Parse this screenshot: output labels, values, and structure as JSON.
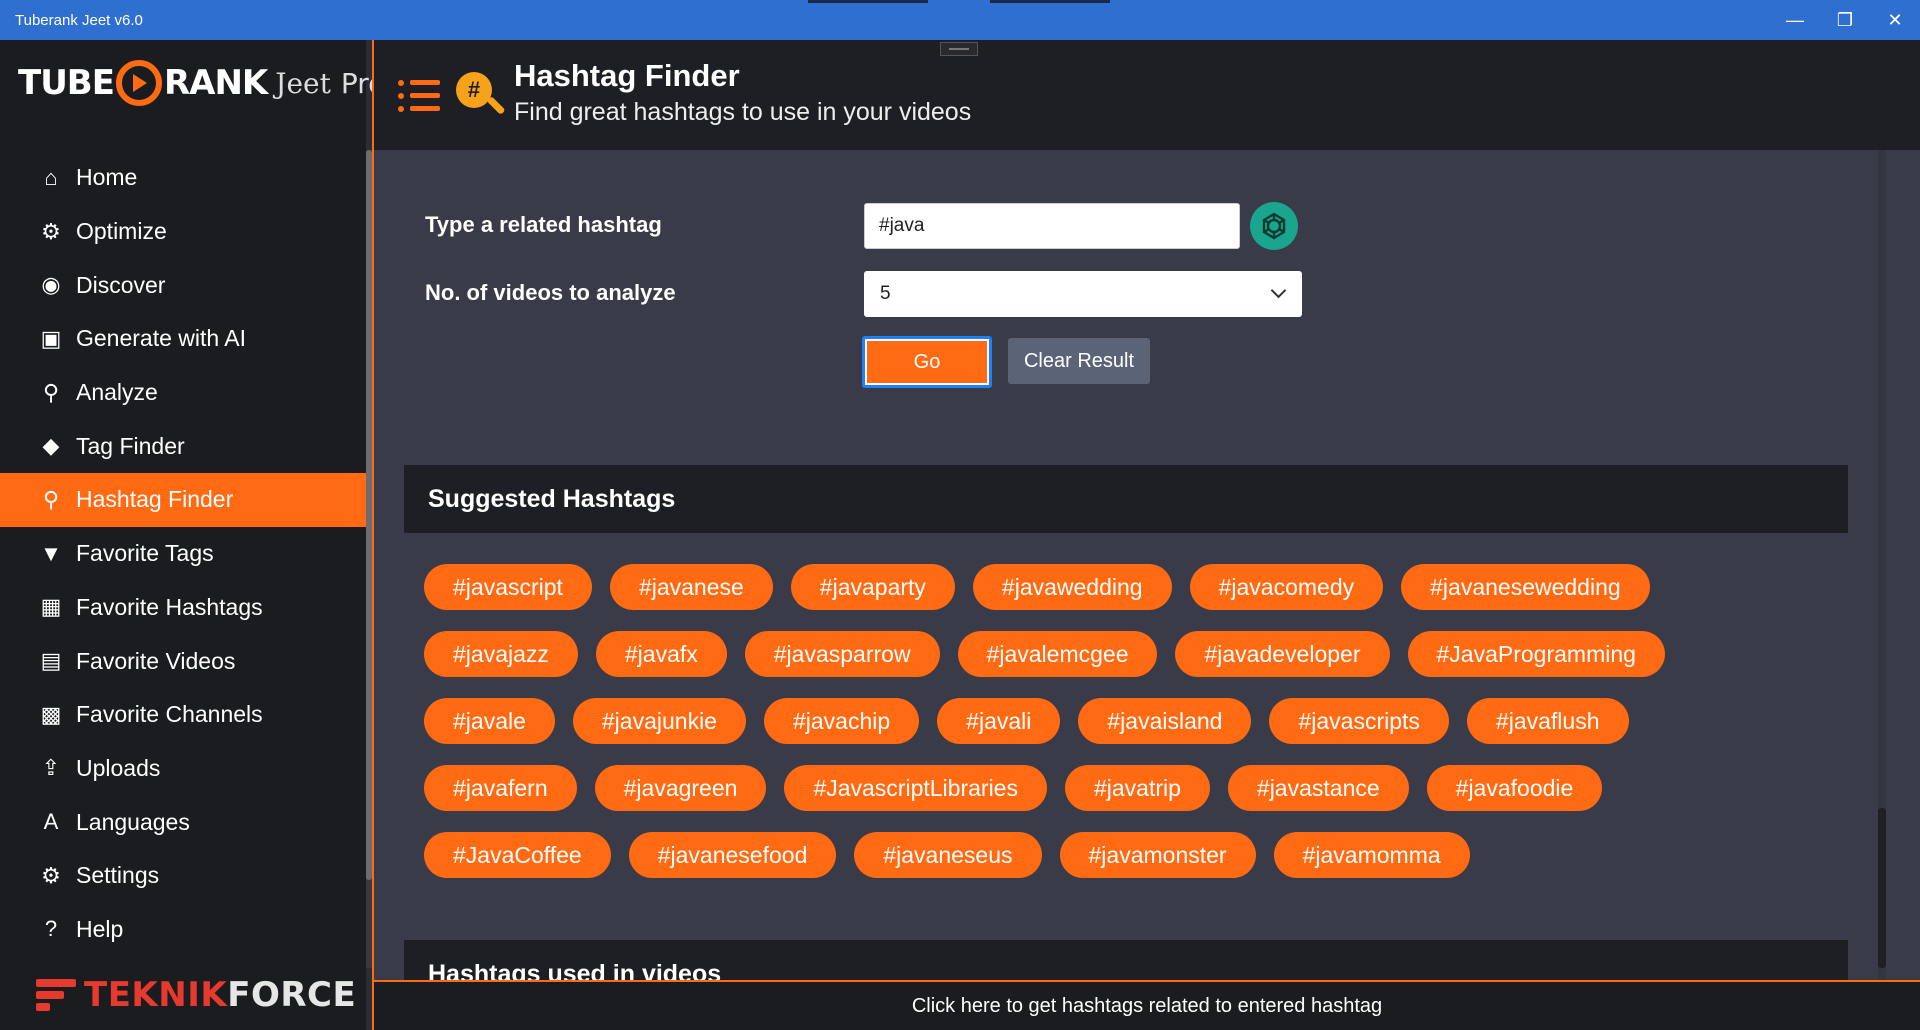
{
  "window": {
    "title": "Tuberank Jeet v6.0",
    "minimize": "—",
    "restore": "❐",
    "close": "✕"
  },
  "logo": {
    "part1": "TUBE",
    "part2": "RANK",
    "part3": "Jeet",
    "part4": "Pro"
  },
  "sidebar": {
    "items": [
      {
        "label": "Home",
        "icon": "⌂"
      },
      {
        "label": "Optimize",
        "icon": "⚙"
      },
      {
        "label": "Discover",
        "icon": "◉"
      },
      {
        "label": "Generate with AI",
        "icon": "▣"
      },
      {
        "label": "Analyze",
        "icon": "⚲"
      },
      {
        "label": "Tag Finder",
        "icon": "◆"
      },
      {
        "label": "Hashtag Finder",
        "icon": "⚲"
      },
      {
        "label": "Favorite Tags",
        "icon": "▼"
      },
      {
        "label": "Favorite Hashtags",
        "icon": "▦"
      },
      {
        "label": "Favorite Videos",
        "icon": "▤"
      },
      {
        "label": "Favorite Channels",
        "icon": "▩"
      },
      {
        "label": "Uploads",
        "icon": "⇪"
      },
      {
        "label": "Languages",
        "icon": "A"
      },
      {
        "label": "Settings",
        "icon": "⚙"
      },
      {
        "label": "Help",
        "icon": "?"
      }
    ],
    "active_index": 6
  },
  "brand": {
    "teknik_a": "TEKNIK",
    "teknik_b": "FORCE"
  },
  "header": {
    "title": "Hashtag Finder",
    "subtitle": "Find great hashtags to use in your videos"
  },
  "form": {
    "hashtag_label": "Type a related hashtag",
    "hashtag_value": "#java",
    "videos_label": "No. of videos to analyze",
    "videos_value": "5",
    "go_label": "Go",
    "clear_label": "Clear Result"
  },
  "suggested": {
    "heading": "Suggested Hashtags",
    "rows": [
      [
        "#javascript",
        "#javanese",
        "#javaparty",
        "#javawedding",
        "#javacomedy",
        "#javanesewedding"
      ],
      [
        "#javajazz",
        "#javafx",
        "#javasparrow",
        "#javalemcgee",
        "#javadeveloper",
        "#JavaProgramming"
      ],
      [
        "#javale",
        "#javajunkie",
        "#javachip",
        "#javali",
        "#javaisland",
        "#javascripts",
        "#javaflush"
      ],
      [
        "#javafern",
        "#javagreen",
        "#JavascriptLibraries",
        "#javatrip",
        "#javastance",
        "#javafoodie"
      ],
      [
        "#JavaCoffee",
        "#javanesefood",
        "#javaneseus",
        "#javamonster",
        "#javamomma"
      ]
    ]
  },
  "used": {
    "heading": "Hashtags used in videos"
  },
  "status": {
    "text": "Click here to get hashtags related to entered hashtag"
  },
  "colors": {
    "accent": "#ff6a13",
    "titlebar": "#2f6fd0",
    "sidebar_bg": "#1b1c20",
    "content_bg": "#393c48"
  }
}
